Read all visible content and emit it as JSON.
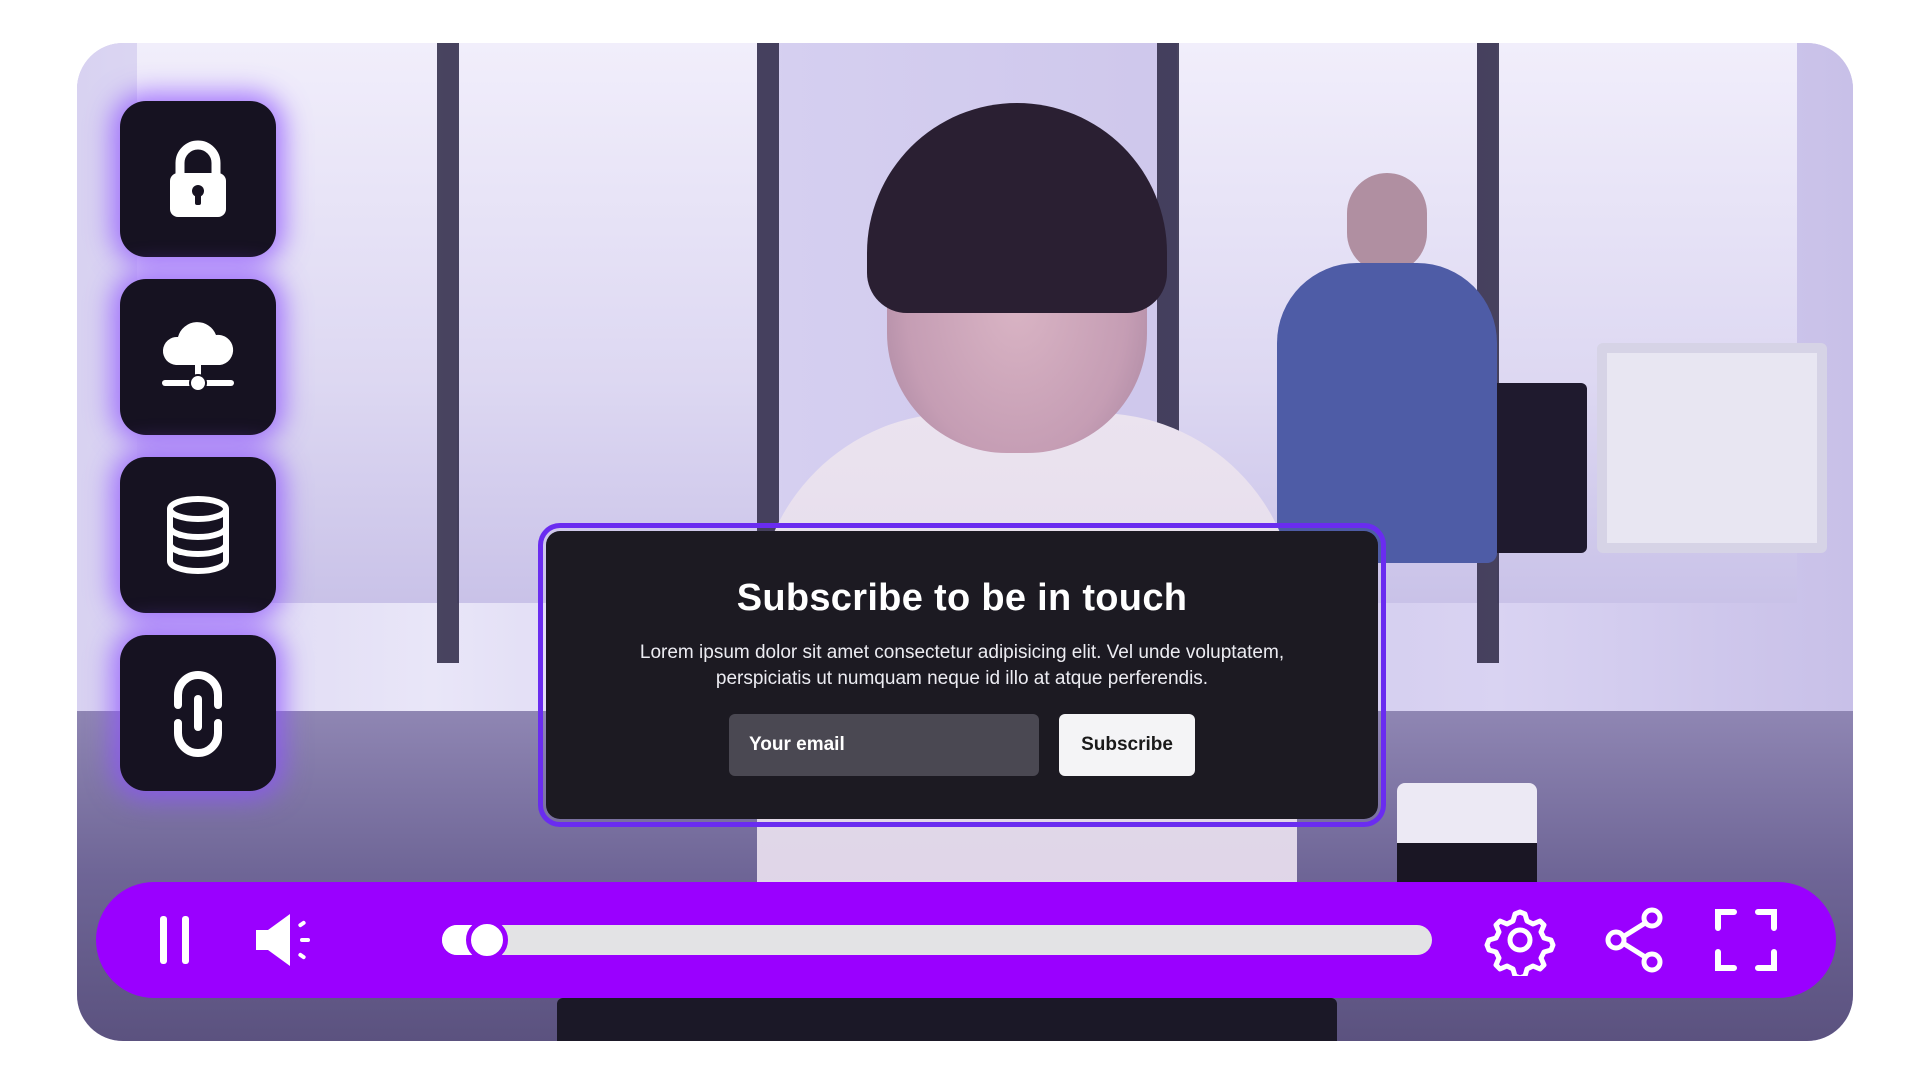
{
  "colors": {
    "accent": "#9a00ff",
    "panel": "#1c1a22",
    "popup_border": "#6a2cf0",
    "side_button": "#161221"
  },
  "side_buttons": [
    {
      "icon": "lock-icon"
    },
    {
      "icon": "cloud-network-icon"
    },
    {
      "icon": "database-icon"
    },
    {
      "icon": "link-icon"
    }
  ],
  "popup": {
    "title": "Subscribe to be in touch",
    "text_line1": "Lorem ipsum dolor sit amet consectetur adipisicing elit. Vel unde voluptatem,",
    "text_line2": "perspiciatis ut numquam neque id illo at atque perferendis.",
    "email_placeholder": "Your email",
    "subscribe_label": "Subscribe"
  },
  "controls": {
    "play_state_icon": "pause-icon",
    "volume_icon": "volume-icon",
    "settings_icon": "gear-icon",
    "share_icon": "share-icon",
    "fullscreen_icon": "fullscreen-icon",
    "progress_fraction": 0.045
  }
}
